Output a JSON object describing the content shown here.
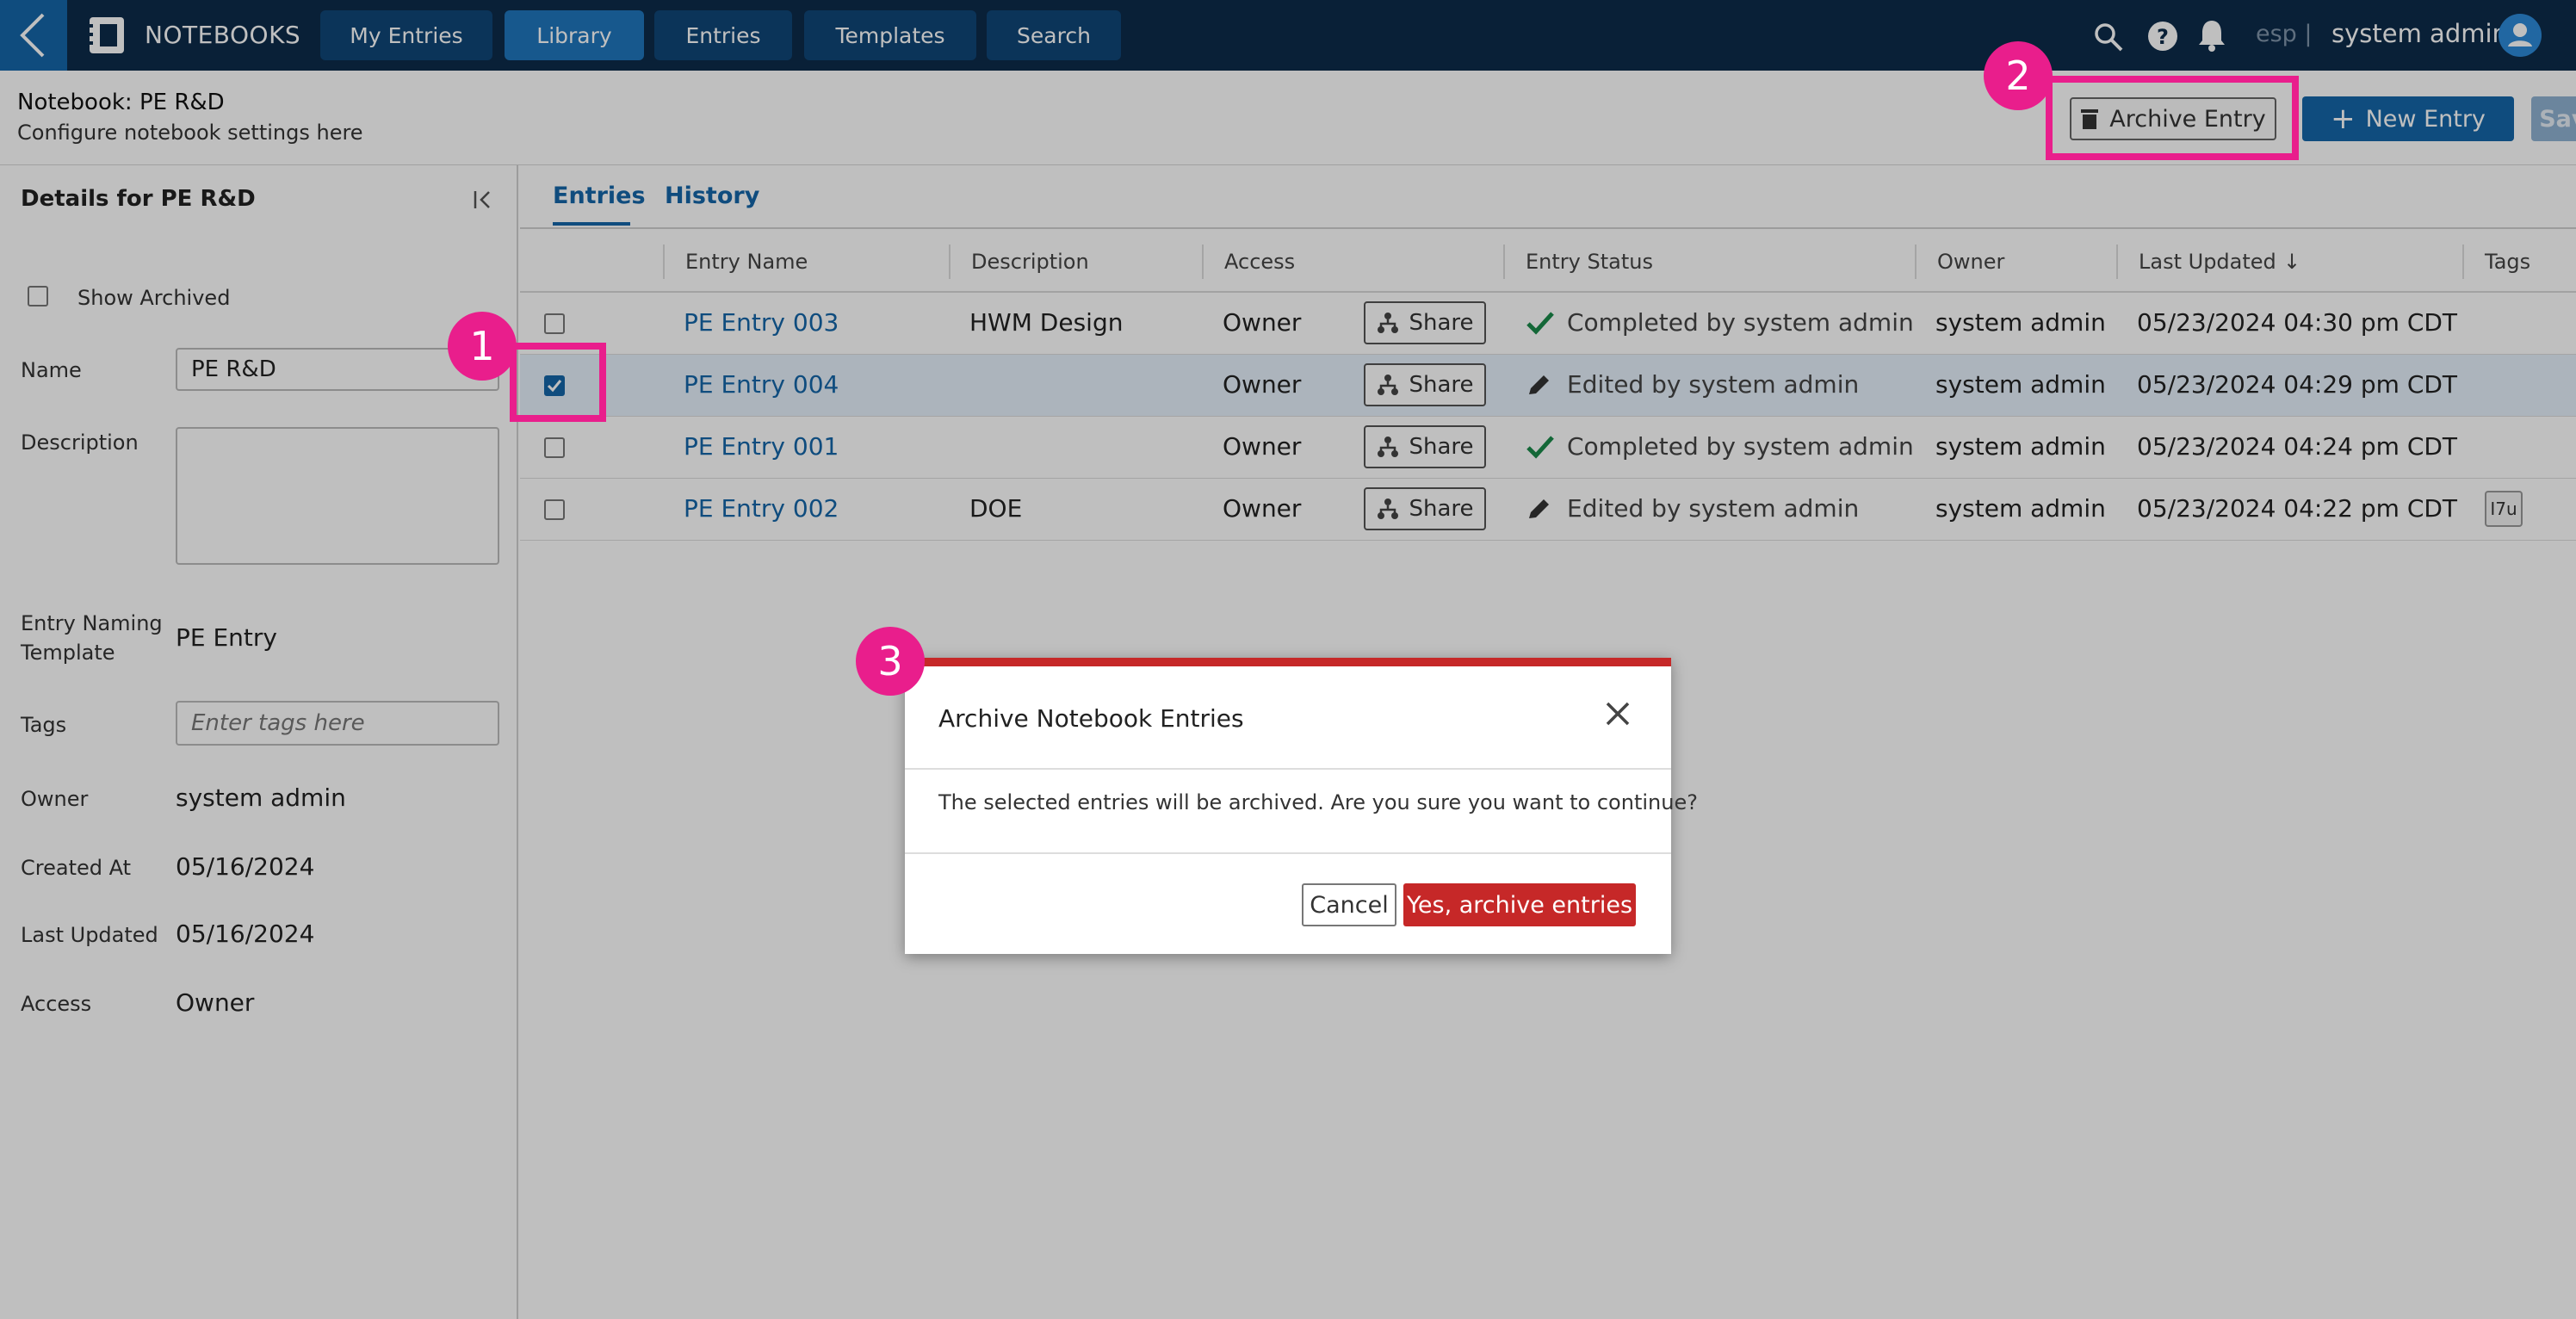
{
  "header": {
    "brand": "NOTEBOOKS",
    "nav": [
      {
        "label": "My Entries",
        "active": false
      },
      {
        "label": "Library",
        "active": true
      },
      {
        "label": "Entries",
        "active": false
      },
      {
        "label": "Templates",
        "active": false
      },
      {
        "label": "Search",
        "active": false
      }
    ],
    "lang": "esp |",
    "user": "system admin",
    "icons": [
      "search-icon",
      "help-icon",
      "bell-icon",
      "user-avatar-icon"
    ]
  },
  "page": {
    "title": "Notebook: PE R&D",
    "subtitle": "Configure notebook settings here",
    "archive_label": "Archive Entry",
    "new_label": "New Entry",
    "save_label": "Save"
  },
  "details": {
    "title": "Details for PE R&D",
    "show_archived": "Show Archived",
    "name_label": "Name",
    "name_value": "PE R&D",
    "description_label": "Description",
    "template_label_1": "Entry Naming",
    "template_label_2": "Template",
    "template_value": "PE Entry",
    "tags_label": "Tags",
    "tags_placeholder": "Enter tags here",
    "owner_label": "Owner",
    "owner_value": "system admin",
    "created_label": "Created At",
    "created_value": "05/16/2024",
    "updated_label": "Last Updated",
    "updated_value": "05/16/2024",
    "access_label": "Access",
    "access_value": "Owner"
  },
  "tabs": [
    {
      "label": "Entries",
      "active": true
    },
    {
      "label": "History",
      "active": false
    }
  ],
  "table": {
    "headers": [
      "Entry Name",
      "Description",
      "Access",
      "Entry Status",
      "Owner",
      "Last Updated",
      "Tags"
    ],
    "sort_indicator": "↓",
    "share_label": "Share",
    "rows": [
      {
        "name": "PE Entry 003",
        "description": "HWM Design",
        "access": "Owner",
        "status": "Completed by system admin",
        "status_icon": "check-icon",
        "owner": "system admin",
        "updated": "05/23/2024 04:30 pm CDT",
        "tag": "",
        "selected": false
      },
      {
        "name": "PE Entry 004",
        "description": "",
        "access": "Owner",
        "status": "Edited by system admin",
        "status_icon": "pencil-icon",
        "owner": "system admin",
        "updated": "05/23/2024 04:29 pm CDT",
        "tag": "",
        "selected": true
      },
      {
        "name": "PE Entry 001",
        "description": "",
        "access": "Owner",
        "status": "Completed by system admin",
        "status_icon": "check-icon",
        "owner": "system admin",
        "updated": "05/23/2024 04:24 pm CDT",
        "tag": "",
        "selected": false
      },
      {
        "name": "PE Entry 002",
        "description": "DOE",
        "access": "Owner",
        "status": "Edited by system admin",
        "status_icon": "pencil-icon",
        "owner": "system admin",
        "updated": "05/23/2024 04:22 pm CDT",
        "tag": "I7u",
        "selected": false
      }
    ]
  },
  "modal": {
    "title": "Archive Notebook Entries",
    "message": "The selected entries will be archived. Are you sure you want to continue?",
    "cancel_label": "Cancel",
    "confirm_label": "Yes, archive entries"
  },
  "callouts": [
    "1",
    "2",
    "3"
  ],
  "colors": {
    "accent": "#1466a8",
    "nav_bg": "#0d2b4a",
    "danger": "#c62828",
    "callout": "#e91e8c"
  }
}
